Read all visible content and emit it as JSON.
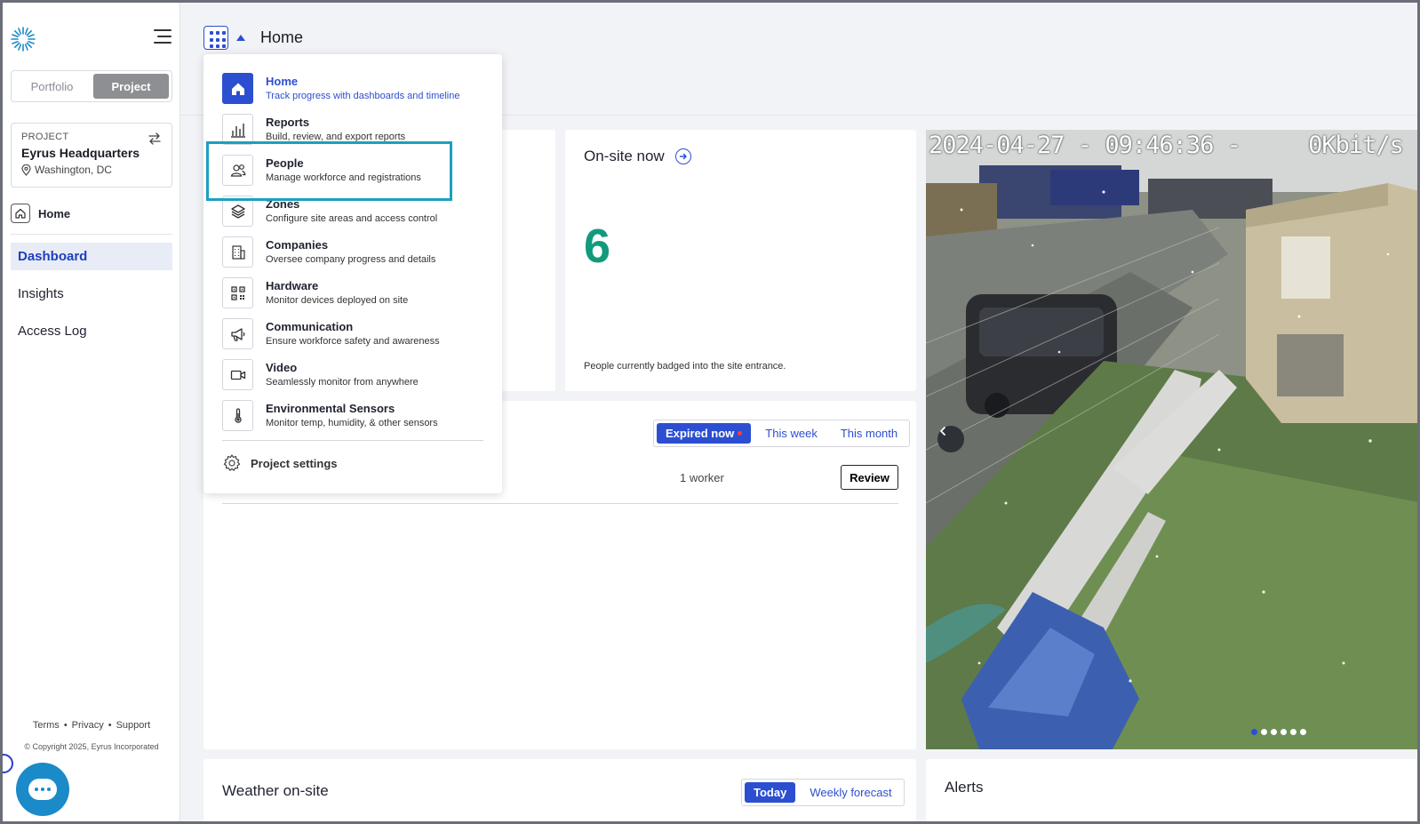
{
  "sidebar": {
    "logo_icon": "sunburst-logo-icon",
    "mode_tabs": [
      {
        "label": "Portfolio",
        "active": false
      },
      {
        "label": "Project",
        "active": true
      }
    ],
    "project": {
      "label": "PROJECT",
      "name": "Eyrus Headquarters",
      "location": "Washington, DC"
    },
    "home_label": "Home",
    "nav": [
      {
        "label": "Dashboard",
        "active": true
      },
      {
        "label": "Insights",
        "active": false
      },
      {
        "label": "Access Log",
        "active": false
      }
    ],
    "footer_links": [
      "Terms",
      "Privacy",
      "Support"
    ],
    "copyright": "© Copyright 2025, Eyrus Incorporated"
  },
  "header": {
    "title": "Home"
  },
  "apps_menu": {
    "items": [
      {
        "title": "Home",
        "desc": "Track progress with dashboards and timeline",
        "icon": "home-icon",
        "active": true
      },
      {
        "title": "Reports",
        "desc": "Build, review, and export reports",
        "icon": "bar-chart-icon",
        "active": false
      },
      {
        "title": "People",
        "desc": "Manage workforce and registrations",
        "icon": "people-icon",
        "active": false
      },
      {
        "title": "Zones",
        "desc": "Configure site areas and access control",
        "icon": "layers-icon",
        "active": false
      },
      {
        "title": "Companies",
        "desc": "Oversee company progress and details",
        "icon": "building-icon",
        "active": false
      },
      {
        "title": "Hardware",
        "desc": "Monitor devices deployed on site",
        "icon": "qr-code-icon",
        "active": false
      },
      {
        "title": "Communication",
        "desc": "Ensure workforce safety and awareness",
        "icon": "megaphone-icon",
        "active": false
      },
      {
        "title": "Video",
        "desc": "Seamlessly monitor from anywhere",
        "icon": "video-camera-icon",
        "active": false
      },
      {
        "title": "Environmental Sensors",
        "desc": "Monitor temp, humidity, & other sensors",
        "icon": "thermometer-icon",
        "active": false
      }
    ],
    "settings_label": "Project settings",
    "highlighted_item": "People"
  },
  "onsite": {
    "title": "On-site now",
    "count": "6",
    "description": "People currently badged into the site entrance."
  },
  "expiry": {
    "tabs": [
      {
        "label": "Expired now",
        "active": true,
        "alert_dot": true
      },
      {
        "label": "This week",
        "active": false
      },
      {
        "label": "This month",
        "active": false
      }
    ],
    "worker_count": "1 worker",
    "review_label": "Review"
  },
  "camera": {
    "timestamp": "2024-04-27 - 09:46:36 -     0Kbit/s",
    "slides": 6,
    "active_slide": 0
  },
  "weather": {
    "title": "Weather on-site",
    "tabs": [
      {
        "label": "Today",
        "active": true
      },
      {
        "label": "Weekly forecast",
        "active": false
      }
    ]
  },
  "alerts": {
    "title": "Alerts"
  },
  "colors": {
    "accent": "#2c4fd1",
    "count_green": "#129a7c",
    "highlight": "#1ba0c0",
    "chat": "#1a8ac9"
  }
}
